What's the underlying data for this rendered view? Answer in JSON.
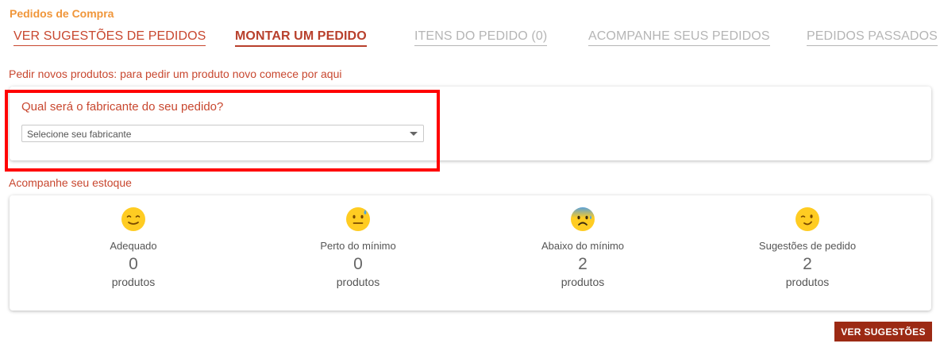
{
  "page": {
    "title": "Pedidos de Compra"
  },
  "tabs": [
    {
      "label": "VER SUGESTÕES DE PEDIDOS",
      "state": "link"
    },
    {
      "label": "MONTAR UM PEDIDO",
      "state": "active"
    },
    {
      "label": "ITENS DO PEDIDO (0)",
      "state": "disabled"
    },
    {
      "label": "ACOMPANHE SEUS PEDIDOS",
      "state": "disabled"
    },
    {
      "label": "PEDIDOS PASSADOS",
      "state": "disabled"
    }
  ],
  "new_products": {
    "intro": "Pedir novos produtos: para pedir um produto novo comece por aqui",
    "question": "Qual será o fabricante do seu pedido?",
    "select_value": "Selecione seu fabricante"
  },
  "stock": {
    "heading": "Acompanhe seu estoque",
    "stats": [
      {
        "label": "Adequado",
        "value": "0",
        "unit": "produtos",
        "icon": "smiling-face-icon"
      },
      {
        "label": "Perto do mínimo",
        "value": "0",
        "unit": "produtos",
        "icon": "neutral-sweat-face-icon"
      },
      {
        "label": "Abaixo do mínimo",
        "value": "2",
        "unit": "produtos",
        "icon": "anxious-sweat-face-icon"
      },
      {
        "label": "Sugestões de pedido",
        "value": "2",
        "unit": "produtos",
        "icon": "winking-face-icon"
      }
    ]
  },
  "actions": {
    "suggestions_button": "VER SUGESTÕES"
  },
  "colors": {
    "title": "#f0963a",
    "accent": "#c8472f",
    "disabled": "#b5b5b5",
    "button": "#9c2a14",
    "highlight": "#ff0000",
    "emoji": "#ffcc22"
  }
}
